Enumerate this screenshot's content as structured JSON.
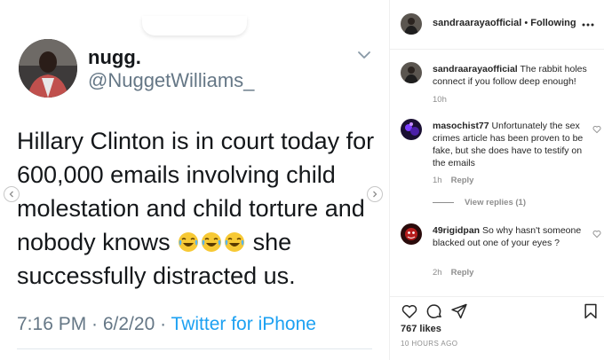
{
  "tweet": {
    "display_name": "nugg.",
    "handle": "@NuggetWilliams_",
    "text_before": "Hillary Clinton is in court today for 600,000 emails involving child molestation and child torture and nobody knows ",
    "emoji_name": "face-with-tears-of-joy",
    "emoji_count": 3,
    "text_after": " she successfully distracted us.",
    "time": "7:16 PM · 6/2/20 · ",
    "source": "Twitter for iPhone"
  },
  "header": {
    "username": "sandraarayaofficial",
    "separator": " • ",
    "follow_status": "Following"
  },
  "comments": [
    {
      "username": "sandraarayaofficial",
      "text": "The rabbit holes connect if you follow deep enough!",
      "time": "10h",
      "reply_label": ""
    },
    {
      "username": "masochist77",
      "text": "Unfortunately the sex crimes article has been proven to be fake, but she does have to testify on the emails",
      "time": "1h",
      "reply_label": "Reply"
    },
    {
      "username": "49rigidpan",
      "text": "So why hasn't someone blacked out one of your eyes ?",
      "time": "2h",
      "reply_label": "Reply"
    }
  ],
  "view_replies": "View replies (1)",
  "likes": "767 likes",
  "time_ago": "10 HOURS AGO",
  "colors": {
    "twitter_blue": "#1da1f2",
    "muted": "#8e8e8e",
    "text": "#262626"
  }
}
